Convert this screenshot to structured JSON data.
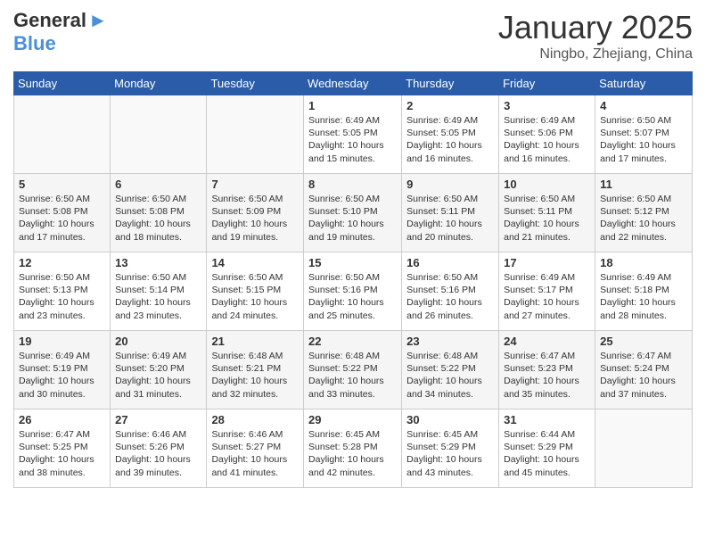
{
  "header": {
    "logo_general": "General",
    "logo_blue": "Blue",
    "title": "January 2025",
    "subtitle": "Ningbo, Zhejiang, China"
  },
  "weekdays": [
    "Sunday",
    "Monday",
    "Tuesday",
    "Wednesday",
    "Thursday",
    "Friday",
    "Saturday"
  ],
  "weeks": [
    [
      {
        "day": "",
        "info": ""
      },
      {
        "day": "",
        "info": ""
      },
      {
        "day": "",
        "info": ""
      },
      {
        "day": "1",
        "info": "Sunrise: 6:49 AM\nSunset: 5:05 PM\nDaylight: 10 hours\nand 15 minutes."
      },
      {
        "day": "2",
        "info": "Sunrise: 6:49 AM\nSunset: 5:05 PM\nDaylight: 10 hours\nand 16 minutes."
      },
      {
        "day": "3",
        "info": "Sunrise: 6:49 AM\nSunset: 5:06 PM\nDaylight: 10 hours\nand 16 minutes."
      },
      {
        "day": "4",
        "info": "Sunrise: 6:50 AM\nSunset: 5:07 PM\nDaylight: 10 hours\nand 17 minutes."
      }
    ],
    [
      {
        "day": "5",
        "info": "Sunrise: 6:50 AM\nSunset: 5:08 PM\nDaylight: 10 hours\nand 17 minutes."
      },
      {
        "day": "6",
        "info": "Sunrise: 6:50 AM\nSunset: 5:08 PM\nDaylight: 10 hours\nand 18 minutes."
      },
      {
        "day": "7",
        "info": "Sunrise: 6:50 AM\nSunset: 5:09 PM\nDaylight: 10 hours\nand 19 minutes."
      },
      {
        "day": "8",
        "info": "Sunrise: 6:50 AM\nSunset: 5:10 PM\nDaylight: 10 hours\nand 19 minutes."
      },
      {
        "day": "9",
        "info": "Sunrise: 6:50 AM\nSunset: 5:11 PM\nDaylight: 10 hours\nand 20 minutes."
      },
      {
        "day": "10",
        "info": "Sunrise: 6:50 AM\nSunset: 5:11 PM\nDaylight: 10 hours\nand 21 minutes."
      },
      {
        "day": "11",
        "info": "Sunrise: 6:50 AM\nSunset: 5:12 PM\nDaylight: 10 hours\nand 22 minutes."
      }
    ],
    [
      {
        "day": "12",
        "info": "Sunrise: 6:50 AM\nSunset: 5:13 PM\nDaylight: 10 hours\nand 23 minutes."
      },
      {
        "day": "13",
        "info": "Sunrise: 6:50 AM\nSunset: 5:14 PM\nDaylight: 10 hours\nand 23 minutes."
      },
      {
        "day": "14",
        "info": "Sunrise: 6:50 AM\nSunset: 5:15 PM\nDaylight: 10 hours\nand 24 minutes."
      },
      {
        "day": "15",
        "info": "Sunrise: 6:50 AM\nSunset: 5:16 PM\nDaylight: 10 hours\nand 25 minutes."
      },
      {
        "day": "16",
        "info": "Sunrise: 6:50 AM\nSunset: 5:16 PM\nDaylight: 10 hours\nand 26 minutes."
      },
      {
        "day": "17",
        "info": "Sunrise: 6:49 AM\nSunset: 5:17 PM\nDaylight: 10 hours\nand 27 minutes."
      },
      {
        "day": "18",
        "info": "Sunrise: 6:49 AM\nSunset: 5:18 PM\nDaylight: 10 hours\nand 28 minutes."
      }
    ],
    [
      {
        "day": "19",
        "info": "Sunrise: 6:49 AM\nSunset: 5:19 PM\nDaylight: 10 hours\nand 30 minutes."
      },
      {
        "day": "20",
        "info": "Sunrise: 6:49 AM\nSunset: 5:20 PM\nDaylight: 10 hours\nand 31 minutes."
      },
      {
        "day": "21",
        "info": "Sunrise: 6:48 AM\nSunset: 5:21 PM\nDaylight: 10 hours\nand 32 minutes."
      },
      {
        "day": "22",
        "info": "Sunrise: 6:48 AM\nSunset: 5:22 PM\nDaylight: 10 hours\nand 33 minutes."
      },
      {
        "day": "23",
        "info": "Sunrise: 6:48 AM\nSunset: 5:22 PM\nDaylight: 10 hours\nand 34 minutes."
      },
      {
        "day": "24",
        "info": "Sunrise: 6:47 AM\nSunset: 5:23 PM\nDaylight: 10 hours\nand 35 minutes."
      },
      {
        "day": "25",
        "info": "Sunrise: 6:47 AM\nSunset: 5:24 PM\nDaylight: 10 hours\nand 37 minutes."
      }
    ],
    [
      {
        "day": "26",
        "info": "Sunrise: 6:47 AM\nSunset: 5:25 PM\nDaylight: 10 hours\nand 38 minutes."
      },
      {
        "day": "27",
        "info": "Sunrise: 6:46 AM\nSunset: 5:26 PM\nDaylight: 10 hours\nand 39 minutes."
      },
      {
        "day": "28",
        "info": "Sunrise: 6:46 AM\nSunset: 5:27 PM\nDaylight: 10 hours\nand 41 minutes."
      },
      {
        "day": "29",
        "info": "Sunrise: 6:45 AM\nSunset: 5:28 PM\nDaylight: 10 hours\nand 42 minutes."
      },
      {
        "day": "30",
        "info": "Sunrise: 6:45 AM\nSunset: 5:29 PM\nDaylight: 10 hours\nand 43 minutes."
      },
      {
        "day": "31",
        "info": "Sunrise: 6:44 AM\nSunset: 5:29 PM\nDaylight: 10 hours\nand 45 minutes."
      },
      {
        "day": "",
        "info": ""
      }
    ]
  ]
}
